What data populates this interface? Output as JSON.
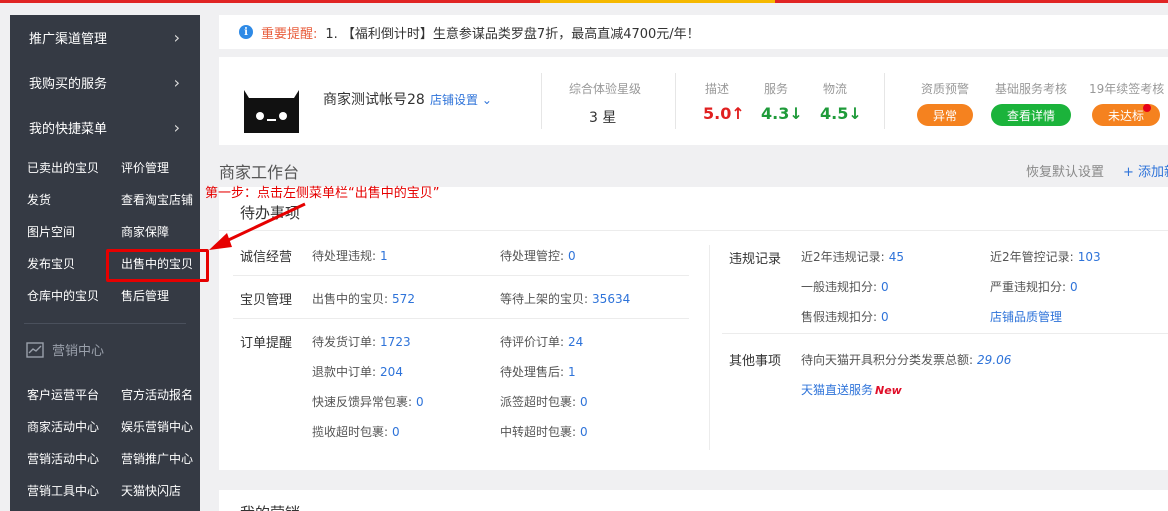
{
  "sidebar": {
    "sections": [
      {
        "label": "推广渠道管理"
      },
      {
        "label": "我购买的服务"
      },
      {
        "label": "我的快捷菜单"
      }
    ],
    "shortcuts": [
      [
        "已卖出的宝贝",
        "评价管理"
      ],
      [
        "发货",
        "查看淘宝店铺"
      ],
      [
        "图片空间",
        "商家保障"
      ],
      [
        "发布宝贝",
        "出售中的宝贝"
      ],
      [
        "仓库中的宝贝",
        "售后管理"
      ]
    ],
    "marketing_title": "营销中心",
    "marketing_links": [
      [
        "客户运营平台",
        "官方活动报名"
      ],
      [
        "商家活动中心",
        "娱乐营销中心"
      ],
      [
        "营销活动中心",
        "营销推广中心"
      ],
      [
        "营销工具中心",
        "天猫快闪店"
      ]
    ]
  },
  "notice": {
    "label": "重要提醒:",
    "text": "1. 【福利倒计时】生意参谋品类罗盘7折，最高直减4700元/年！"
  },
  "account": {
    "name": "商家测试帐号28",
    "settings_label": "店铺设置",
    "rating_label": "综合体验星级",
    "rating_value": "3 星",
    "metrics": [
      {
        "label": "描述",
        "value": "5.0↑",
        "color": "#e02020"
      },
      {
        "label": "服务",
        "value": "4.3↓",
        "color": "#1f9b3a"
      },
      {
        "label": "物流",
        "value": "4.5↓",
        "color": "#1f9b3a"
      }
    ],
    "checks": [
      {
        "label": "资质预警",
        "badge": "异常",
        "color": "#f5821f"
      },
      {
        "label": "基础服务考核",
        "badge": "查看详情",
        "color": "#1bb33b"
      },
      {
        "label": "19年续签考核",
        "badge": "未达标",
        "color": "#f5821f"
      }
    ]
  },
  "workbench": {
    "title": "商家工作台",
    "reset_label": "恢复默认设置",
    "add_label": "+ 添加新"
  },
  "todo": {
    "title": "待办事项",
    "integrity": {
      "label": "诚信经营",
      "items": [
        {
          "name": "待处理违规:",
          "value": "1"
        },
        {
          "name": "待处理管控:",
          "value": "0"
        }
      ]
    },
    "goods": {
      "label": "宝贝管理",
      "items": [
        {
          "name": "出售中的宝贝:",
          "value": "572"
        },
        {
          "name": "等待上架的宝贝:",
          "value": "35634"
        }
      ]
    },
    "orders": {
      "label": "订单提醒",
      "items": [
        {
          "name": "待发货订单:",
          "value": "1723"
        },
        {
          "name": "待评价订单:",
          "value": "24"
        },
        {
          "name": "退款中订单:",
          "value": "204"
        },
        {
          "name": "待处理售后:",
          "value": "1"
        },
        {
          "name": "快速反馈异常包裹:",
          "value": "0"
        },
        {
          "name": "派签超时包裹:",
          "value": "0"
        },
        {
          "name": "揽收超时包裹:",
          "value": "0"
        },
        {
          "name": "中转超时包裹:",
          "value": "0"
        }
      ]
    },
    "violations": {
      "label": "违规记录",
      "items": [
        {
          "name": "近2年违规记录:",
          "value": "45"
        },
        {
          "name": "近2年管控记录:",
          "value": "103"
        },
        {
          "name": "一般违规扣分:",
          "value": "0"
        },
        {
          "name": "严重违规扣分:",
          "value": "0"
        },
        {
          "name": "售假违规扣分:",
          "value": "0"
        }
      ],
      "link": "店铺品质管理"
    },
    "other": {
      "label": "其他事项",
      "invoice_name": "待向天猫开具积分分类发票总额:",
      "invoice_value": "29.06",
      "direct_link": "天猫直送服务",
      "direct_new": "New"
    }
  },
  "marketing_panel": {
    "title": "我的营销"
  },
  "annotation": {
    "text": "第一步：点击左侧菜单栏“出售中的宝贝”"
  }
}
